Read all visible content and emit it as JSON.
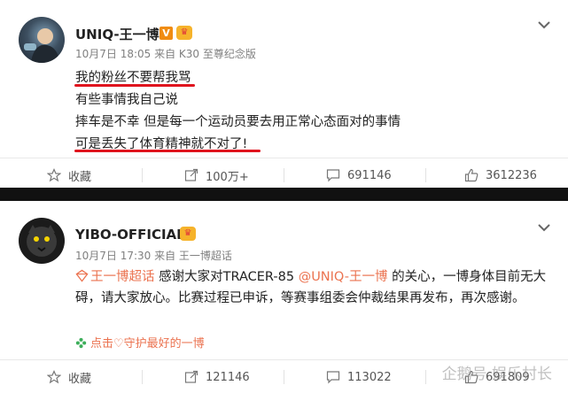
{
  "posts": [
    {
      "username": "UNIQ-王一博",
      "meta": "10月7日 18:05 来自 K30 至尊纪念版",
      "lines": [
        "我的粉丝不要帮我骂",
        "有些事情我自己说",
        "摔车是不幸 但是每一个运动员要去用正常心态面对的事情",
        "可是丢失了体育精神就不对了!"
      ],
      "actions": {
        "fav": "收藏",
        "repost": "100万+",
        "comment": "691146",
        "like": "3612236"
      }
    },
    {
      "username": "YIBO-OFFICIAL",
      "meta": "10月7日 17:30 来自 王一博超话",
      "topic": "王一博超话",
      "text_a": " 感谢大家对TRACER-85 ",
      "mention": "@UNIQ-王一博",
      "text_b": " 的关心，一博身体目前无大碍，请大家放心。比赛过程已申诉，等赛事组委会仲裁结果再发布，再次感谢。",
      "link": "点击♡守护最好的一博",
      "actions": {
        "fav": "收藏",
        "repost": "121146",
        "comment": "113022",
        "like": "691809"
      }
    }
  ],
  "watermark": "企鹅号 娱乐村长",
  "colors": {
    "accent": "#eb7350",
    "underline": "#e0141e",
    "divider": "#111111"
  }
}
